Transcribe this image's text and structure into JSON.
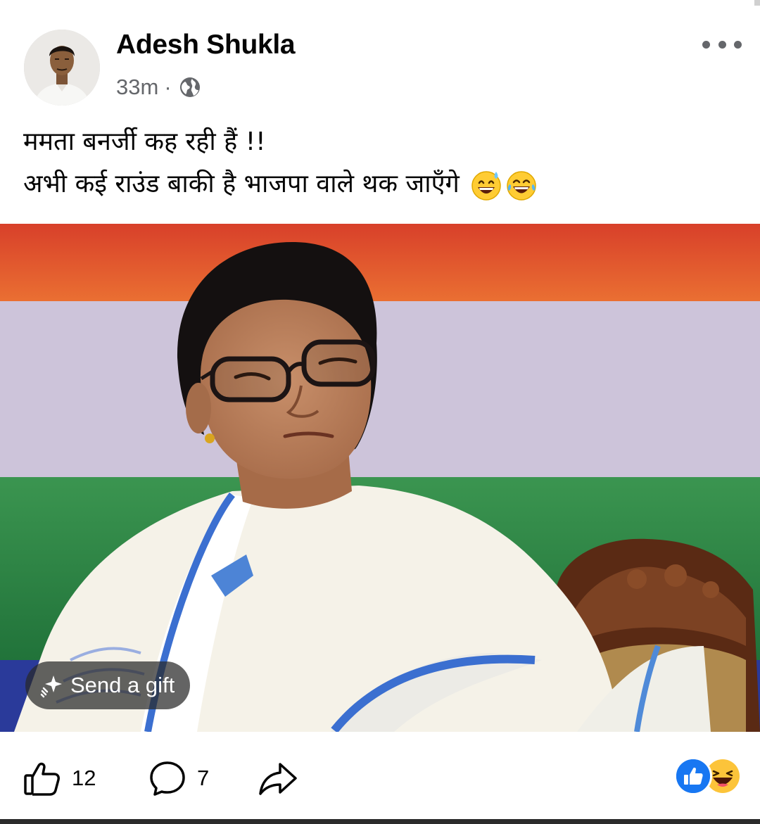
{
  "post": {
    "author": "Adesh Shukla",
    "timestamp": "33m",
    "separator": "·",
    "audience_icon": "globe-icon",
    "text_lines": [
      "ममता बनर्जी कह रही हैं !!",
      "अभी कई राउंड बाकी है भाजपा वाले थक जाएँगे"
    ],
    "text_emojis": [
      "grinning-sweat-emoji",
      "tears-of-joy-emoji"
    ]
  },
  "photo": {
    "gift_button_label": "Send a gift",
    "gift_icon": "gift-sparkle-icon"
  },
  "actions": {
    "like_count": "12",
    "comment_count": "7",
    "like_icon": "thumbs-up-icon",
    "comment_icon": "comment-bubble-icon",
    "share_icon": "share-arrow-icon"
  },
  "reactions": [
    "like-reaction-icon",
    "haha-reaction-icon"
  ],
  "colors": {
    "brand_blue": "#1877f2",
    "meta_gray": "#65676b",
    "flag_saffron": "#d95428",
    "flag_white": "#cfc5dc",
    "flag_green": "#2f8a45"
  }
}
